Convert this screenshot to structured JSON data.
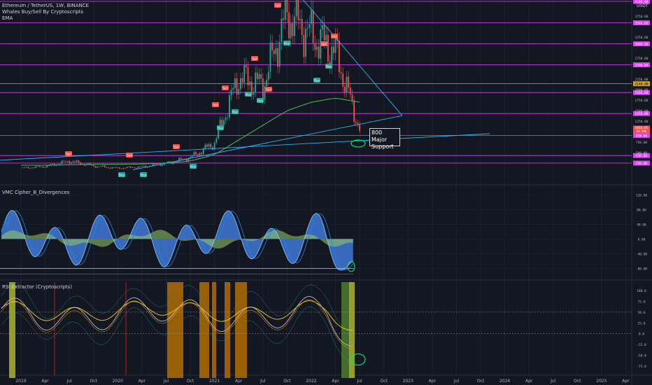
{
  "header": {
    "symbol_line": "Ethereum / TetherUS, 1W, BINANCE",
    "indicator_1": "Whales Buy/Sell By Cryptoscripts",
    "indicator_2": "EMA",
    "currency": "USDT"
  },
  "panes": {
    "wavetrend_title": "VMC Cipher_B_Divergences",
    "rsi_title": "RSI Extractor (Cryptoscripts)"
  },
  "annotation": {
    "line1": "800 Major",
    "line2": "Support"
  },
  "signals": {
    "buy": "Buy",
    "sell": "Sell"
  },
  "colors": {
    "background": "#131722",
    "up_candle": "#26a69a",
    "down_candle": "#ef5350",
    "ema": "#4caf50",
    "trendline": "#29b6f6",
    "magenta": "#e040fb",
    "gold": "#c9a227",
    "wave_blue": "#3f78d6",
    "rsi_yellow": "#f5d000",
    "rsi_orange": "#ff9800",
    "marker_green": "#00e676"
  },
  "chart_data": [
    {
      "type": "line",
      "name": "price",
      "x": [
        "2019-01",
        "2019-04",
        "2019-07",
        "2019-10",
        "2020-01",
        "2020-04",
        "2020-07",
        "2020-10",
        "2021-01",
        "2021-04",
        "2021-07",
        "2021-10",
        "2022-01",
        "2022-04",
        "2022-06"
      ],
      "values": [
        130,
        170,
        300,
        180,
        130,
        160,
        240,
        380,
        730,
        2300,
        2100,
        3800,
        3300,
        2900,
        1050
      ],
      "ema_values": [
        200,
        200,
        210,
        220,
        220,
        230,
        250,
        300,
        450,
        800,
        1150,
        1500,
        1700,
        1800,
        1700
      ],
      "ylim": [
        0,
        4300
      ],
      "price_axis_ticks": [
        "3750.00",
        "3250.00",
        "2750.00",
        "2250.00",
        "2000.00",
        "1750.00",
        "1500.00",
        "1250.00",
        "750.00",
        "500.00"
      ],
      "last_price_label": "1056.85",
      "last_price_sub": "4d 19h",
      "horizontal_levels": [
        4100,
        3590,
        3090,
        2590,
        1930,
        1430,
        910,
        430,
        250
      ],
      "level_labels": [
        "4100.00",
        "3590.00",
        "3090.00",
        "2590.00",
        "1930.00",
        "1430.00",
        "910.00",
        "430.00",
        "250.00"
      ],
      "gold_level": 2140,
      "gold_level_label": "2140.00"
    },
    {
      "type": "area",
      "name": "wavetrend",
      "ticks": [
        "120.00",
        "80.00",
        "40.00",
        "0.00",
        "-40.00",
        "-80.00"
      ],
      "ylim": [
        -100,
        130
      ]
    },
    {
      "type": "line",
      "name": "rsi",
      "ticks": [
        "100.0",
        "75.0",
        "50.0",
        "25.0",
        "0.0",
        "-25.0",
        "-50.0",
        "-75.0"
      ],
      "ylim": [
        -90,
        110
      ]
    }
  ],
  "time_axis": [
    "2019",
    "Apr",
    "Jul",
    "Oct",
    "2020",
    "Apr",
    "Jul",
    "Oct",
    "2021",
    "Apr",
    "Jul",
    "Oct",
    "2022",
    "Apr",
    "Jul",
    "Oct",
    "2023",
    "Apr",
    "Jul",
    "Oct",
    "2024",
    "Apr",
    "Jul",
    "Oct",
    "2025",
    "Apr"
  ]
}
